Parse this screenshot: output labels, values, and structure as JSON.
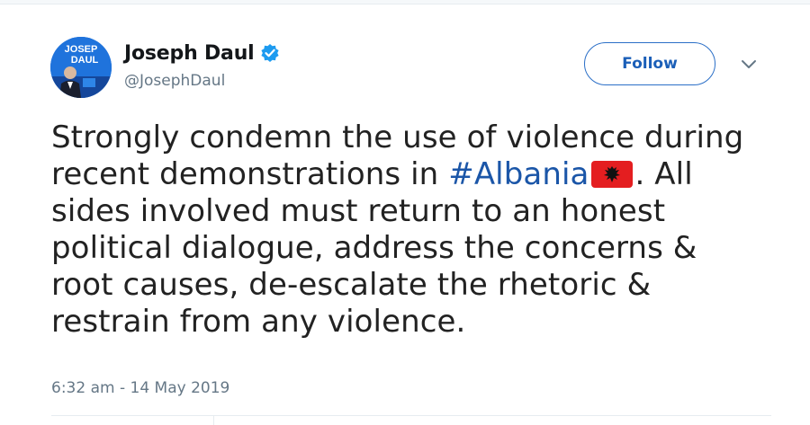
{
  "author": {
    "display_name": "Joseph Daul",
    "handle": "@JosephDaul",
    "verified": true,
    "avatar_text_line1": "JOSEP",
    "avatar_text_line2": "DAUL"
  },
  "actions": {
    "follow_label": "Follow",
    "more_icon": "chevron-down-icon"
  },
  "tweet": {
    "line1": "Strongly condemn the use of violence during",
    "line2_before": "recent demonstrations in ",
    "hashtag": "#Albania",
    "flag_icon": "albania-flag-emoji",
    "line2_after": ". All",
    "line3": "sides involved must return to an honest",
    "line4": "political dialogue, address the concerns &",
    "line5": "root causes, de-escalate the rhetoric &",
    "line6": "restrain from any violence."
  },
  "timestamp": "6:32 am - 14 May 2019",
  "colors": {
    "accent": "#1b56a8",
    "secondary_text": "#657786",
    "flag_red": "#e41e20"
  }
}
